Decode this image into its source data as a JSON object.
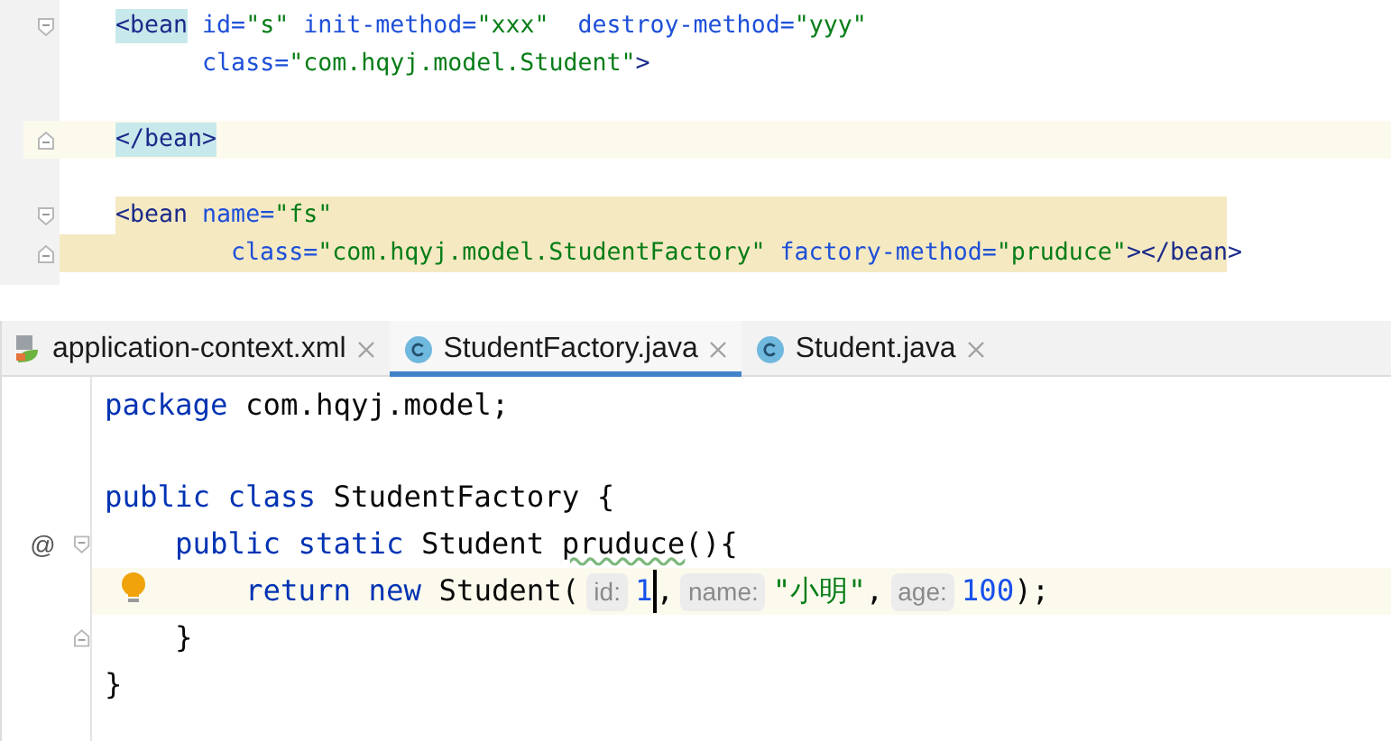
{
  "xml_editor": {
    "lines": [
      {
        "kind": "open",
        "current": false,
        "selected": false,
        "tokens": [
          {
            "text": "<bean",
            "kind": "tag",
            "matched": true
          },
          {
            "text": " id=",
            "kind": "attr"
          },
          {
            "text": "\"s\"",
            "kind": "value"
          },
          {
            "text": " init-method=",
            "kind": "attr"
          },
          {
            "text": "\"xxx\"",
            "kind": "value"
          },
          {
            "text": "  destroy-method=",
            "kind": "attr"
          },
          {
            "text": "\"yyy\"",
            "kind": "value"
          }
        ]
      },
      {
        "kind": "plain",
        "current": false,
        "selected": false,
        "tokens": [
          {
            "text": "      class=",
            "kind": "attr"
          },
          {
            "text": "\"com.hqyj.model.Student\"",
            "kind": "value"
          },
          {
            "text": ">",
            "kind": "tag",
            "matched": false
          }
        ]
      },
      {
        "kind": "plain",
        "current": false,
        "selected": false
      },
      {
        "kind": "close",
        "current": true,
        "selected": false,
        "tokens": [
          {
            "text": "</bean>",
            "kind": "tag",
            "matched": true
          }
        ]
      },
      {
        "kind": "plain",
        "current": false,
        "selected": false
      },
      {
        "kind": "open",
        "current": false,
        "selected": true,
        "tokens": [
          {
            "text": "<bean",
            "kind": "tag",
            "matched": false
          },
          {
            "text": " name=",
            "kind": "attr"
          },
          {
            "text": "\"fs\"",
            "kind": "value"
          }
        ]
      },
      {
        "kind": "close",
        "current": false,
        "selected": true,
        "tokens": [
          {
            "text": "        class=",
            "kind": "attr"
          },
          {
            "text": "\"com.hqyj.model.StudentFactory\"",
            "kind": "value"
          },
          {
            "text": " factory-method=",
            "kind": "attr"
          },
          {
            "text": "\"pruduce\"",
            "kind": "value"
          },
          {
            "text": "></bean>",
            "kind": "tag",
            "matched": false
          }
        ]
      }
    ]
  },
  "tabs": [
    {
      "label": "application-context.xml",
      "kind": "xml",
      "selected": false
    },
    {
      "label": "StudentFactory.java",
      "kind": "class",
      "selected": true
    },
    {
      "label": "Student.java",
      "kind": "class",
      "selected": false
    }
  ],
  "java_editor": {
    "lines": [
      {
        "kind": "plain",
        "current": false,
        "bulb": false,
        "tokens": [
          {
            "text": "package",
            "kind": "keyword"
          },
          {
            "text": " com.hqyj.model;",
            "kind": "plain"
          }
        ]
      },
      {
        "kind": "plain",
        "current": false,
        "bulb": false
      },
      {
        "kind": "plain",
        "current": false,
        "bulb": false,
        "tokens": [
          {
            "text": "public",
            "kind": "keyword"
          },
          {
            "text": " class",
            "kind": "keyword"
          },
          {
            "text": " StudentFactory {",
            "kind": "plain"
          }
        ]
      },
      {
        "kind": "open",
        "current": false,
        "bulb": false,
        "marker": "@",
        "tokens": [
          {
            "text": "    public",
            "kind": "keyword"
          },
          {
            "text": " static",
            "kind": "keyword"
          },
          {
            "text": " Student ",
            "kind": "plain"
          },
          {
            "text": "pruduce",
            "kind": "plain",
            "typo": true
          },
          {
            "text": "(){",
            "kind": "plain"
          }
        ]
      },
      {
        "kind": "plain",
        "current": true,
        "bulb": true,
        "tokens": [
          {
            "text": "        return",
            "kind": "keyword"
          },
          {
            "text": " new",
            "kind": "keyword"
          },
          {
            "text": " Student(",
            "kind": "plain"
          },
          {
            "text": "id:",
            "kind": "hint"
          },
          {
            "text": "1",
            "kind": "number",
            "caret": true
          },
          {
            "text": ",",
            "kind": "plain"
          },
          {
            "text": "name:",
            "kind": "hint"
          },
          {
            "text": "\"小明\"",
            "kind": "string"
          },
          {
            "text": ",",
            "kind": "plain"
          },
          {
            "text": "age:",
            "kind": "hint"
          },
          {
            "text": "100",
            "kind": "number",
            "caret": false
          },
          {
            "text": ");",
            "kind": "plain"
          }
        ]
      },
      {
        "kind": "close",
        "current": false,
        "bulb": false,
        "tokens": [
          {
            "text": "    }",
            "kind": "plain"
          }
        ]
      },
      {
        "kind": "plain",
        "current": false,
        "bulb": false,
        "tokens": [
          {
            "text": "}",
            "kind": "plain"
          }
        ]
      }
    ]
  }
}
